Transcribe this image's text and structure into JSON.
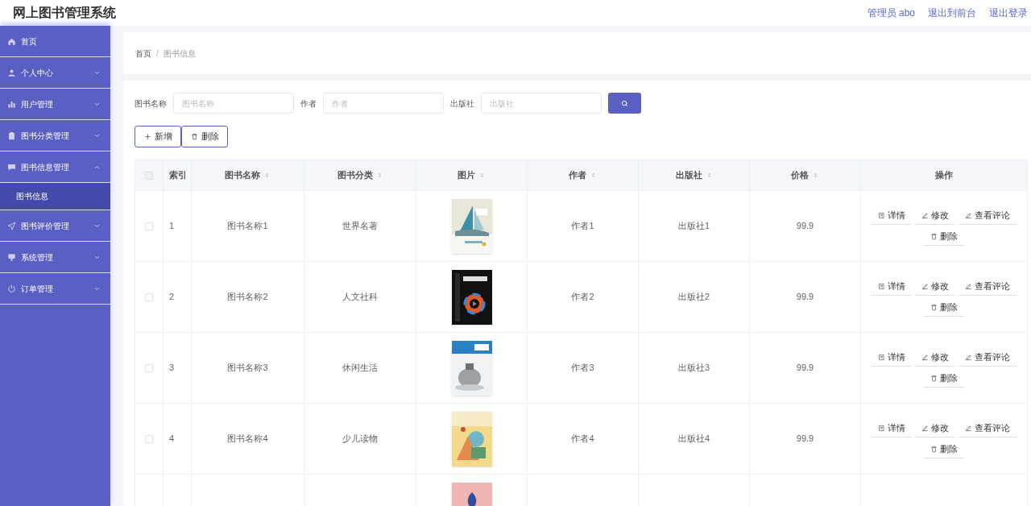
{
  "header": {
    "title": "网上图书管理系统",
    "links": [
      "管理员 abo",
      "退出到前台",
      "退出登录"
    ]
  },
  "sidebar": {
    "items": [
      {
        "kind": "link",
        "label": "首页"
      },
      {
        "kind": "menu",
        "label": "个人中心",
        "expanded": false
      },
      {
        "kind": "menu",
        "label": "用户管理",
        "expanded": false
      },
      {
        "kind": "menu",
        "label": "图书分类管理",
        "expanded": false
      },
      {
        "kind": "menu",
        "label": "图书信息管理",
        "expanded": true,
        "children": [
          {
            "label": "图书信息",
            "selected": true
          }
        ]
      },
      {
        "kind": "menu",
        "label": "图书评价管理",
        "expanded": false
      },
      {
        "kind": "menu",
        "label": "系统管理",
        "expanded": false
      },
      {
        "kind": "menu",
        "label": "订单管理",
        "expanded": false
      }
    ]
  },
  "breadcrumb": {
    "separator": "/",
    "items": [
      "首页",
      "图书信息"
    ]
  },
  "search": {
    "fields": [
      {
        "label": "图书名称",
        "placeholder": "图书名称"
      },
      {
        "label": "作者",
        "placeholder": "作者"
      },
      {
        "label": "出版社",
        "placeholder": "出版社"
      }
    ]
  },
  "toolbar": [
    {
      "kind": "add",
      "label": "新增"
    },
    {
      "kind": "delete",
      "label": "删除"
    }
  ],
  "table": {
    "select_all_checked": false,
    "columns": [
      {
        "label": "索引",
        "sortable": false
      },
      {
        "label": "图书名称",
        "sortable": true
      },
      {
        "label": "图书分类",
        "sortable": true
      },
      {
        "label": "图片",
        "sortable": true
      },
      {
        "label": "作者",
        "sortable": true
      },
      {
        "label": "出版社",
        "sortable": true
      },
      {
        "label": "价格",
        "sortable": true
      },
      {
        "label": "操作",
        "sortable": false
      }
    ],
    "rows": [
      {
        "checked": false,
        "index": "1",
        "name": "图书名称1",
        "category": "世界名著",
        "cover": {
          "kind": "picture"
        },
        "author": "作者1",
        "publisher": "出版社1",
        "price": "99.9",
        "actions": [
          {
            "kind": "detail",
            "label": "详情"
          },
          {
            "kind": "edit",
            "label": "修改"
          },
          {
            "kind": "edit",
            "label": "查看评论"
          },
          {
            "kind": "delete",
            "label": "删除"
          }
        ]
      },
      {
        "checked": false,
        "index": "2",
        "name": "图书名称2",
        "category": "人文社科",
        "cover": {
          "kind": "picture"
        },
        "author": "作者2",
        "publisher": "出版社2",
        "price": "99.9",
        "actions": [
          {
            "kind": "detail",
            "label": "详情"
          },
          {
            "kind": "edit",
            "label": "修改"
          },
          {
            "kind": "edit",
            "label": "查看评论"
          },
          {
            "kind": "delete",
            "label": "删除"
          }
        ]
      },
      {
        "checked": false,
        "index": "3",
        "name": "图书名称3",
        "category": "休闲生活",
        "cover": {
          "kind": "picture"
        },
        "author": "作者3",
        "publisher": "出版社3",
        "price": "99.9",
        "actions": [
          {
            "kind": "detail",
            "label": "详情"
          },
          {
            "kind": "edit",
            "label": "修改"
          },
          {
            "kind": "edit",
            "label": "查看评论"
          },
          {
            "kind": "delete",
            "label": "删除"
          }
        ]
      },
      {
        "checked": false,
        "index": "4",
        "name": "图书名称4",
        "category": "少儿读物",
        "cover": {
          "kind": "picture"
        },
        "author": "作者4",
        "publisher": "出版社4",
        "price": "99.9",
        "actions": [
          {
            "kind": "detail",
            "label": "详情"
          },
          {
            "kind": "edit",
            "label": "修改"
          },
          {
            "kind": "edit",
            "label": "查看评论"
          },
          {
            "kind": "delete",
            "label": "删除"
          }
        ]
      },
      {
        "cover": {
          "kind": "picture"
        }
      }
    ]
  }
}
